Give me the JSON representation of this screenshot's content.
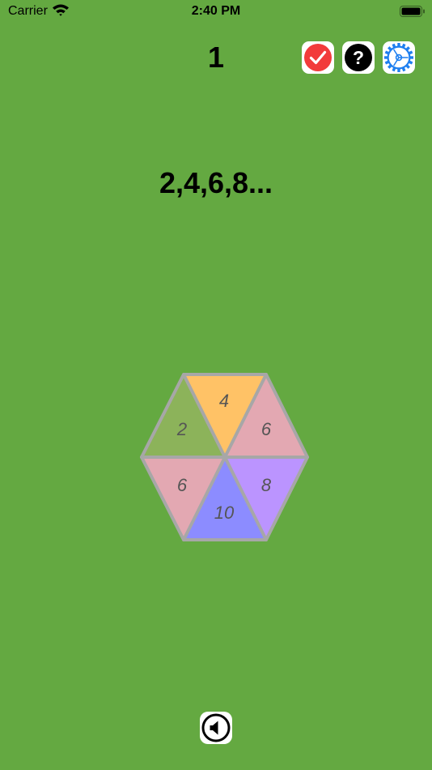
{
  "status_bar": {
    "carrier": "Carrier",
    "time": "2:40 PM"
  },
  "header": {
    "level": "1"
  },
  "toolbar": {
    "check_icon": "checkmark-icon",
    "help_icon": "question-mark-icon",
    "settings_icon": "gear-icon",
    "help_glyph": "?"
  },
  "puzzle": {
    "sequence": "2,4,6,8...",
    "triangles": [
      {
        "label": "2",
        "color": "#8cb35a"
      },
      {
        "label": "4",
        "color": "#ffc266"
      },
      {
        "label": "6",
        "color": "#e3a8b2"
      },
      {
        "label": "6",
        "color": "#e3a8b2"
      },
      {
        "label": "10",
        "color": "#8c8cff"
      },
      {
        "label": "8",
        "color": "#bb94ff"
      }
    ]
  },
  "footer": {
    "sound_icon": "speaker-icon"
  },
  "colors": {
    "background": "#64a941",
    "check_red": "#f23b3b",
    "settings_blue": "#1e7ff0",
    "edge_gray": "#a7a7a7"
  }
}
